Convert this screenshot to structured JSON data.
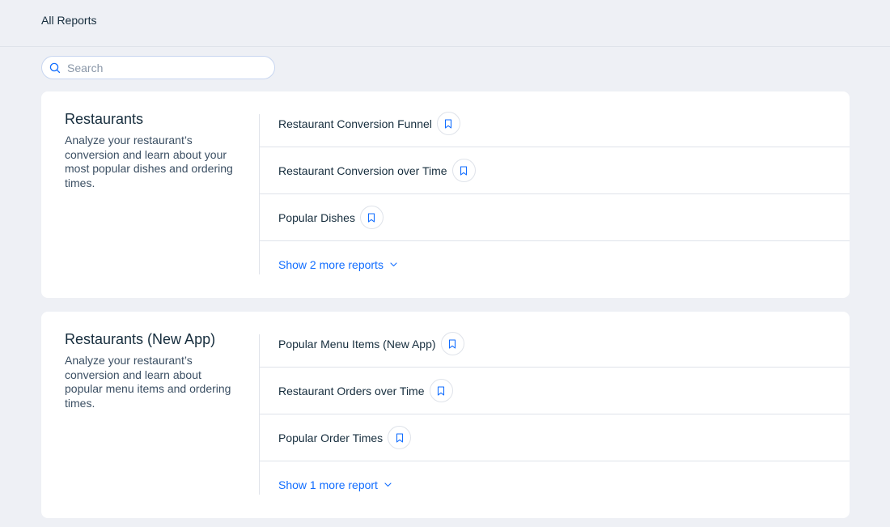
{
  "header": {
    "title": "All Reports"
  },
  "search": {
    "placeholder": "Search",
    "value": ""
  },
  "sections": [
    {
      "title": "Restaurants",
      "description": "Analyze your restaurant’s conversion and learn about your most popular dishes and ordering times.",
      "reports": [
        {
          "label": "Restaurant Conversion Funnel"
        },
        {
          "label": "Restaurant Conversion over Time"
        },
        {
          "label": "Popular Dishes"
        }
      ],
      "show_more": "Show 2 more reports"
    },
    {
      "title": "Restaurants (New App)",
      "description": "Analyze your restaurant’s conversion and learn about popular menu items and ordering times.",
      "reports": [
        {
          "label": "Popular Menu Items (New App)"
        },
        {
          "label": "Restaurant Orders over Time"
        },
        {
          "label": "Popular Order Times"
        }
      ],
      "show_more": "Show 1 more report"
    }
  ],
  "icons": {
    "search": "search-icon",
    "bookmark": "bookmark-icon",
    "chevron": "chevron-down-icon"
  },
  "colors": {
    "accent": "#116dff",
    "background": "#eef0f5",
    "text": "#162d3d"
  }
}
